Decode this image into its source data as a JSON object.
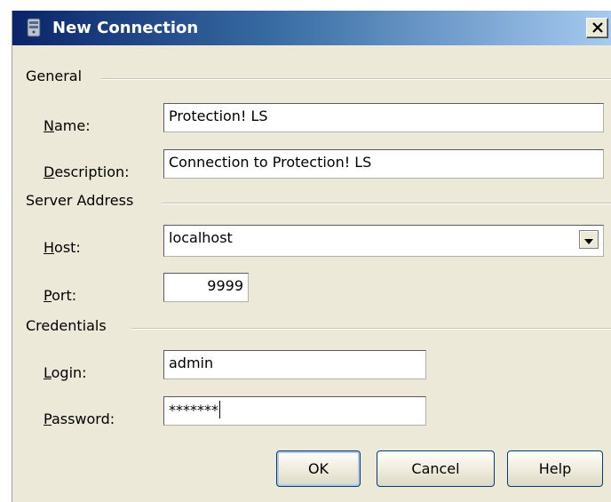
{
  "window": {
    "title": "New Connection",
    "close_glyph": "✕"
  },
  "sections": {
    "general": "General",
    "server_address": "Server Address",
    "credentials": "Credentials"
  },
  "fields": {
    "name": {
      "label_mnemonic": "N",
      "label_rest": "ame:",
      "value": "Protection! LS"
    },
    "description": {
      "label_mnemonic": "D",
      "label_rest": "escription:",
      "value": "Connection to Protection! LS"
    },
    "host": {
      "label_mnemonic": "H",
      "label_rest": "ost:",
      "value": "localhost"
    },
    "port": {
      "label_mnemonic": "P",
      "label_rest": "ort:",
      "value": "9999"
    },
    "login": {
      "label_mnemonic": "L",
      "label_rest": "ogin:",
      "value": "admin"
    },
    "password": {
      "label_mnemonic": "P",
      "label_rest": "assword:",
      "value": "*******"
    }
  },
  "buttons": {
    "ok": "OK",
    "cancel": "Cancel",
    "help": "Help"
  },
  "icons": {
    "title": "server-icon",
    "close": "close-icon",
    "host_dropdown": "chevron-down-icon"
  }
}
